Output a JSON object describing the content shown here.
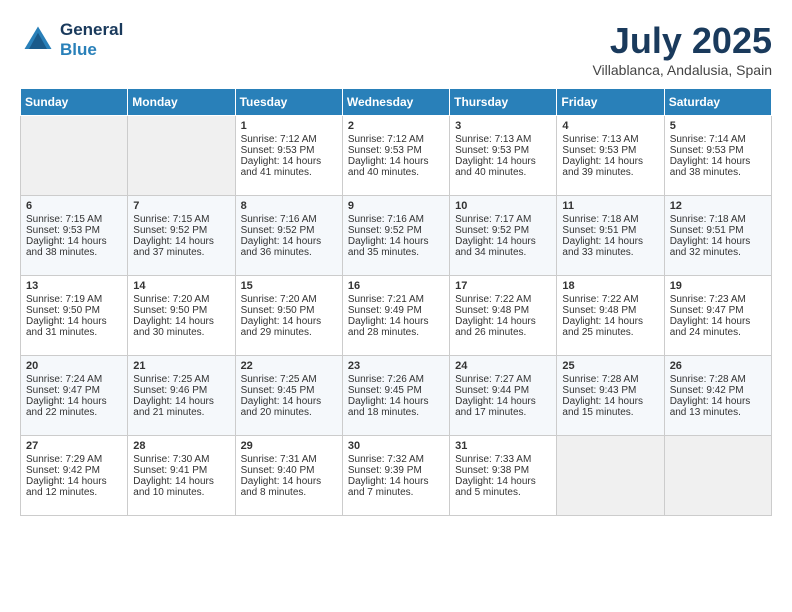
{
  "header": {
    "logo_line1": "General",
    "logo_line2": "Blue",
    "month": "July 2025",
    "location": "Villablanca, Andalusia, Spain"
  },
  "days_of_week": [
    "Sunday",
    "Monday",
    "Tuesday",
    "Wednesday",
    "Thursday",
    "Friday",
    "Saturday"
  ],
  "weeks": [
    [
      {
        "day": "",
        "empty": true
      },
      {
        "day": "",
        "empty": true
      },
      {
        "day": "1",
        "sunrise": "Sunrise: 7:12 AM",
        "sunset": "Sunset: 9:53 PM",
        "daylight": "Daylight: 14 hours and 41 minutes."
      },
      {
        "day": "2",
        "sunrise": "Sunrise: 7:12 AM",
        "sunset": "Sunset: 9:53 PM",
        "daylight": "Daylight: 14 hours and 40 minutes."
      },
      {
        "day": "3",
        "sunrise": "Sunrise: 7:13 AM",
        "sunset": "Sunset: 9:53 PM",
        "daylight": "Daylight: 14 hours and 40 minutes."
      },
      {
        "day": "4",
        "sunrise": "Sunrise: 7:13 AM",
        "sunset": "Sunset: 9:53 PM",
        "daylight": "Daylight: 14 hours and 39 minutes."
      },
      {
        "day": "5",
        "sunrise": "Sunrise: 7:14 AM",
        "sunset": "Sunset: 9:53 PM",
        "daylight": "Daylight: 14 hours and 38 minutes."
      }
    ],
    [
      {
        "day": "6",
        "sunrise": "Sunrise: 7:15 AM",
        "sunset": "Sunset: 9:53 PM",
        "daylight": "Daylight: 14 hours and 38 minutes."
      },
      {
        "day": "7",
        "sunrise": "Sunrise: 7:15 AM",
        "sunset": "Sunset: 9:52 PM",
        "daylight": "Daylight: 14 hours and 37 minutes."
      },
      {
        "day": "8",
        "sunrise": "Sunrise: 7:16 AM",
        "sunset": "Sunset: 9:52 PM",
        "daylight": "Daylight: 14 hours and 36 minutes."
      },
      {
        "day": "9",
        "sunrise": "Sunrise: 7:16 AM",
        "sunset": "Sunset: 9:52 PM",
        "daylight": "Daylight: 14 hours and 35 minutes."
      },
      {
        "day": "10",
        "sunrise": "Sunrise: 7:17 AM",
        "sunset": "Sunset: 9:52 PM",
        "daylight": "Daylight: 14 hours and 34 minutes."
      },
      {
        "day": "11",
        "sunrise": "Sunrise: 7:18 AM",
        "sunset": "Sunset: 9:51 PM",
        "daylight": "Daylight: 14 hours and 33 minutes."
      },
      {
        "day": "12",
        "sunrise": "Sunrise: 7:18 AM",
        "sunset": "Sunset: 9:51 PM",
        "daylight": "Daylight: 14 hours and 32 minutes."
      }
    ],
    [
      {
        "day": "13",
        "sunrise": "Sunrise: 7:19 AM",
        "sunset": "Sunset: 9:50 PM",
        "daylight": "Daylight: 14 hours and 31 minutes."
      },
      {
        "day": "14",
        "sunrise": "Sunrise: 7:20 AM",
        "sunset": "Sunset: 9:50 PM",
        "daylight": "Daylight: 14 hours and 30 minutes."
      },
      {
        "day": "15",
        "sunrise": "Sunrise: 7:20 AM",
        "sunset": "Sunset: 9:50 PM",
        "daylight": "Daylight: 14 hours and 29 minutes."
      },
      {
        "day": "16",
        "sunrise": "Sunrise: 7:21 AM",
        "sunset": "Sunset: 9:49 PM",
        "daylight": "Daylight: 14 hours and 28 minutes."
      },
      {
        "day": "17",
        "sunrise": "Sunrise: 7:22 AM",
        "sunset": "Sunset: 9:48 PM",
        "daylight": "Daylight: 14 hours and 26 minutes."
      },
      {
        "day": "18",
        "sunrise": "Sunrise: 7:22 AM",
        "sunset": "Sunset: 9:48 PM",
        "daylight": "Daylight: 14 hours and 25 minutes."
      },
      {
        "day": "19",
        "sunrise": "Sunrise: 7:23 AM",
        "sunset": "Sunset: 9:47 PM",
        "daylight": "Daylight: 14 hours and 24 minutes."
      }
    ],
    [
      {
        "day": "20",
        "sunrise": "Sunrise: 7:24 AM",
        "sunset": "Sunset: 9:47 PM",
        "daylight": "Daylight: 14 hours and 22 minutes."
      },
      {
        "day": "21",
        "sunrise": "Sunrise: 7:25 AM",
        "sunset": "Sunset: 9:46 PM",
        "daylight": "Daylight: 14 hours and 21 minutes."
      },
      {
        "day": "22",
        "sunrise": "Sunrise: 7:25 AM",
        "sunset": "Sunset: 9:45 PM",
        "daylight": "Daylight: 14 hours and 20 minutes."
      },
      {
        "day": "23",
        "sunrise": "Sunrise: 7:26 AM",
        "sunset": "Sunset: 9:45 PM",
        "daylight": "Daylight: 14 hours and 18 minutes."
      },
      {
        "day": "24",
        "sunrise": "Sunrise: 7:27 AM",
        "sunset": "Sunset: 9:44 PM",
        "daylight": "Daylight: 14 hours and 17 minutes."
      },
      {
        "day": "25",
        "sunrise": "Sunrise: 7:28 AM",
        "sunset": "Sunset: 9:43 PM",
        "daylight": "Daylight: 14 hours and 15 minutes."
      },
      {
        "day": "26",
        "sunrise": "Sunrise: 7:28 AM",
        "sunset": "Sunset: 9:42 PM",
        "daylight": "Daylight: 14 hours and 13 minutes."
      }
    ],
    [
      {
        "day": "27",
        "sunrise": "Sunrise: 7:29 AM",
        "sunset": "Sunset: 9:42 PM",
        "daylight": "Daylight: 14 hours and 12 minutes."
      },
      {
        "day": "28",
        "sunrise": "Sunrise: 7:30 AM",
        "sunset": "Sunset: 9:41 PM",
        "daylight": "Daylight: 14 hours and 10 minutes."
      },
      {
        "day": "29",
        "sunrise": "Sunrise: 7:31 AM",
        "sunset": "Sunset: 9:40 PM",
        "daylight": "Daylight: 14 hours and 8 minutes."
      },
      {
        "day": "30",
        "sunrise": "Sunrise: 7:32 AM",
        "sunset": "Sunset: 9:39 PM",
        "daylight": "Daylight: 14 hours and 7 minutes."
      },
      {
        "day": "31",
        "sunrise": "Sunrise: 7:33 AM",
        "sunset": "Sunset: 9:38 PM",
        "daylight": "Daylight: 14 hours and 5 minutes."
      },
      {
        "day": "",
        "empty": true
      },
      {
        "day": "",
        "empty": true
      }
    ]
  ]
}
